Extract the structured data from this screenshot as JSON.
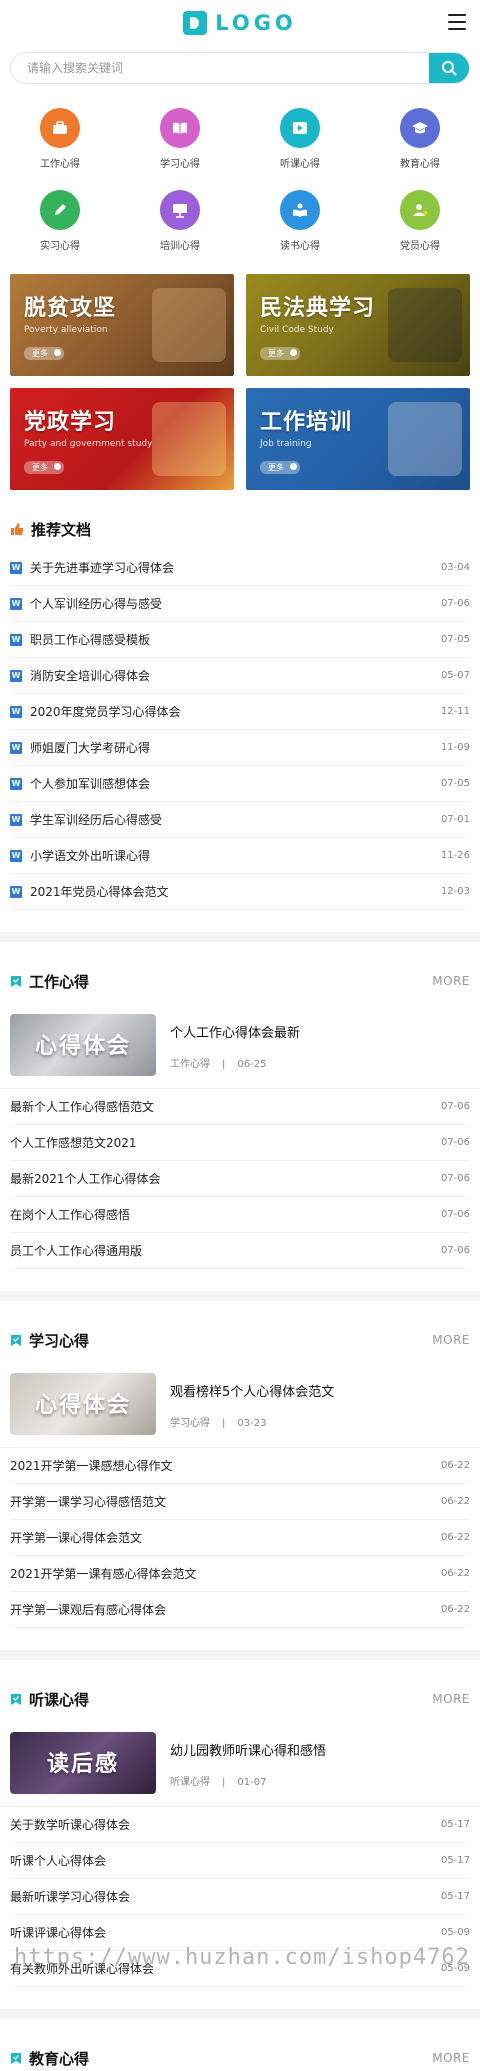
{
  "header": {
    "logo_text": "LOGO"
  },
  "search": {
    "placeholder": "请输入搜索关键词"
  },
  "categories": [
    {
      "label": "工作心得",
      "color": "#f07a2c",
      "icon": "briefcase-icon"
    },
    {
      "label": "学习心得",
      "color": "#d460c9",
      "icon": "book-icon"
    },
    {
      "label": "听课心得",
      "color": "#19b6c8",
      "icon": "play-icon"
    },
    {
      "label": "教育心得",
      "color": "#5c6fd6",
      "icon": "graduation-cap-icon"
    },
    {
      "label": "实习心得",
      "color": "#35b35a",
      "icon": "pencil-icon"
    },
    {
      "label": "培训心得",
      "color": "#9b5fdb",
      "icon": "presentation-icon"
    },
    {
      "label": "读书心得",
      "color": "#2c93e0",
      "icon": "reader-icon"
    },
    {
      "label": "党员心得",
      "color": "#8cc63e",
      "icon": "user-badge-icon"
    }
  ],
  "banners": [
    {
      "title": "脱贫攻坚",
      "subtitle": "Poverty alleviation",
      "more": "更多"
    },
    {
      "title": "民法典学习",
      "subtitle": "Civil Code Study",
      "more": "更多"
    },
    {
      "title": "党政学习",
      "subtitle": "Party and government study",
      "more": "更多"
    },
    {
      "title": "工作培训",
      "subtitle": "Job training",
      "more": "更多"
    }
  ],
  "recommended": {
    "title": "推荐文档",
    "items": [
      {
        "text": "关于先进事迹学习心得体会",
        "date": "03-04"
      },
      {
        "text": "个人军训经历心得与感受",
        "date": "07-06"
      },
      {
        "text": "职员工作心得感受模板",
        "date": "07-05"
      },
      {
        "text": "消防安全培训心得体会",
        "date": "05-07"
      },
      {
        "text": "2020年度党员学习心得体会",
        "date": "12-11"
      },
      {
        "text": "师姐厦门大学考研心得",
        "date": "11-09"
      },
      {
        "text": "个人参加军训感想体会",
        "date": "07-05"
      },
      {
        "text": "学生军训经历后心得感受",
        "date": "07-01"
      },
      {
        "text": "小学语文外出听课心得",
        "date": "11-26"
      },
      {
        "text": "2021年党员心得体会范文",
        "date": "12-03"
      }
    ]
  },
  "sections": [
    {
      "title": "工作心得",
      "more": "MORE",
      "feature": {
        "thumb_text": "心得体会",
        "title": "个人工作心得体会最新",
        "category": "工作心得",
        "sep": "|",
        "date": "06-25"
      },
      "items": [
        {
          "text": "最新个人工作心得感悟范文",
          "date": "07-06"
        },
        {
          "text": "个人工作感想范文2021",
          "date": "07-06"
        },
        {
          "text": "最新2021个人工作心得体会",
          "date": "07-06"
        },
        {
          "text": "在岗个人工作心得感悟",
          "date": "07-06"
        },
        {
          "text": "员工个人工作心得通用版",
          "date": "07-06"
        }
      ]
    },
    {
      "title": "学习心得",
      "more": "MORE",
      "feature": {
        "thumb_text": "心得体会",
        "title": "观看榜样5个人心得体会范文",
        "category": "学习心得",
        "sep": "|",
        "date": "03-23"
      },
      "items": [
        {
          "text": "2021开学第一课感想心得作文",
          "date": "06-22"
        },
        {
          "text": "开学第一课学习心得感悟范文",
          "date": "06-22"
        },
        {
          "text": "开学第一课心得体会范文",
          "date": "06-22"
        },
        {
          "text": "2021开学第一课有感心得体会范文",
          "date": "06-22"
        },
        {
          "text": "开学第一课观后有感心得体会",
          "date": "06-22"
        }
      ]
    },
    {
      "title": "听课心得",
      "more": "MORE",
      "feature": {
        "thumb_text": "读后感",
        "title": "幼儿园教师听课心得和感悟",
        "category": "听课心得",
        "sep": "|",
        "date": "01-07"
      },
      "items": [
        {
          "text": "关于数学听课心得体会",
          "date": "05-17"
        },
        {
          "text": "听课个人心得体会",
          "date": "05-17"
        },
        {
          "text": "最新听课学习心得体会",
          "date": "05-17"
        },
        {
          "text": "听课评课心得体会",
          "date": "05-09"
        },
        {
          "text": "有关教师外出听课心得体会",
          "date": "05-09"
        }
      ]
    },
    {
      "title": "教育心得",
      "more": "MORE"
    }
  ],
  "watermark": "https://www.huzhan.com/ishop4762"
}
